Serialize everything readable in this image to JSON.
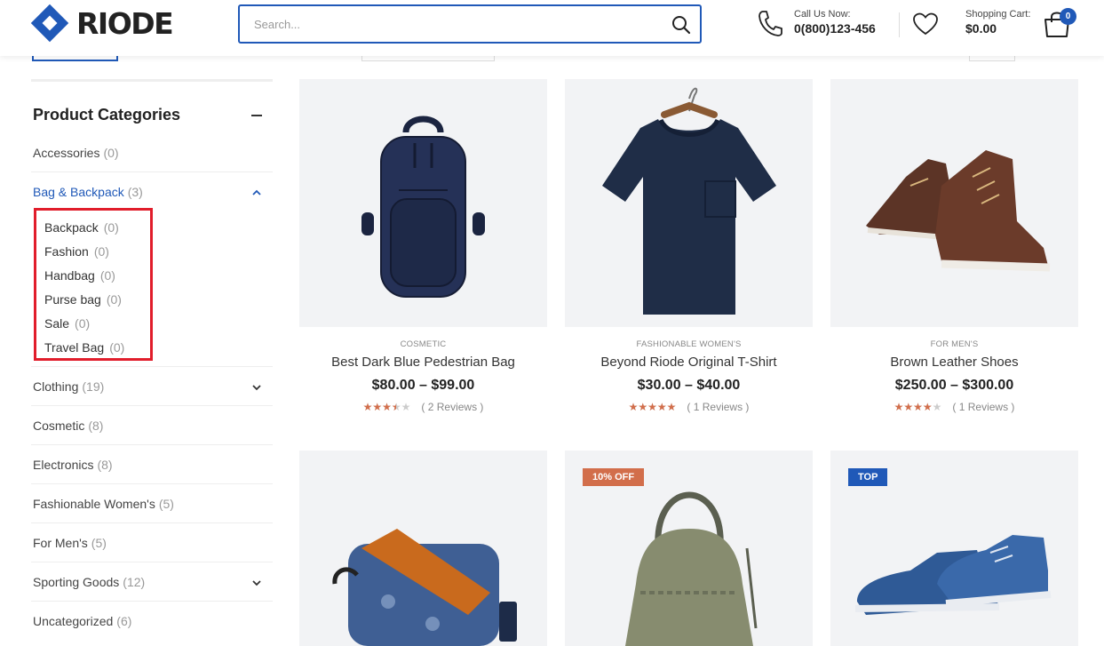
{
  "header": {
    "logo_text": "RIODE",
    "search_placeholder": "Search...",
    "call_label": "Call Us Now:",
    "call_number": "0(800)123-456",
    "cart_label": "Shopping Cart:",
    "cart_total": "$0.00",
    "cart_count": "0",
    "brand_color": "#2059b8"
  },
  "sidebar": {
    "title": "Product Categories",
    "categories": [
      {
        "label": "Accessories",
        "count": "(0)"
      },
      {
        "label": "Bag & Backpack",
        "count": "(3)"
      },
      {
        "label": "Clothing",
        "count": "(19)"
      },
      {
        "label": "Cosmetic",
        "count": "(8)"
      },
      {
        "label": "Electronics",
        "count": "(8)"
      },
      {
        "label": "Fashionable Women's",
        "count": "(5)"
      },
      {
        "label": "For Men's",
        "count": "(5)"
      },
      {
        "label": "Sporting Goods",
        "count": "(12)"
      },
      {
        "label": "Uncategorized",
        "count": "(6)"
      }
    ],
    "subcategories": [
      {
        "label": "Backpack",
        "count": "(0)"
      },
      {
        "label": "Fashion",
        "count": "(0)"
      },
      {
        "label": "Handbag",
        "count": "(0)"
      },
      {
        "label": "Purse bag",
        "count": "(0)"
      },
      {
        "label": "Sale",
        "count": "(0)"
      },
      {
        "label": "Travel Bag",
        "count": "(0)"
      }
    ]
  },
  "products": [
    {
      "category": "COSMETIC",
      "name": "Best Dark Blue Pedestrian Bag",
      "price": "$80.00 – $99.00",
      "rating": 3.5,
      "reviews": "( 2 Reviews )",
      "image": "backpack-image"
    },
    {
      "category": "FASHIONABLE WOMEN'S",
      "name": "Beyond Riode Original T-Shirt",
      "price": "$30.00 – $40.00",
      "rating": 5,
      "reviews": "( 1 Reviews )",
      "image": "tshirt-image"
    },
    {
      "category": "FOR MEN'S",
      "name": "Brown Leather Shoes",
      "price": "$250.00 – $300.00",
      "rating": 4,
      "reviews": "( 1 Reviews )",
      "image": "boots-image"
    },
    {
      "badge": "",
      "image": "camera-bag-image"
    },
    {
      "badge": "10% OFF",
      "image": "bucket-bag-image"
    },
    {
      "badge": "TOP",
      "image": "sneakers-image"
    }
  ]
}
